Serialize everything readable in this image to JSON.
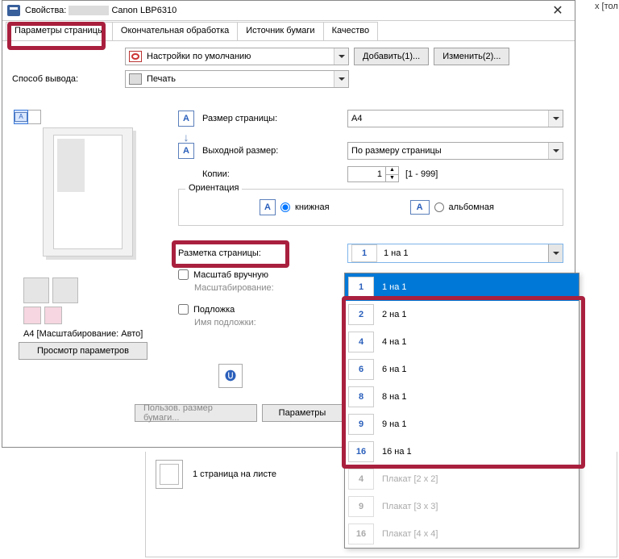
{
  "window": {
    "title_prefix": "Свойства:",
    "printer_name": "Canon LBP6310",
    "close_glyph": "✕"
  },
  "tabs": {
    "page": "Параметры страницы",
    "finish": "Окончательная обработка",
    "source": "Источник бумаги",
    "quality": "Качество"
  },
  "profile": {
    "default_settings": "Настройки по умолчанию",
    "add_btn": "Добавить(1)...",
    "edit_btn": "Изменить(2)..."
  },
  "output": {
    "label": "Способ вывода:",
    "value": "Печать"
  },
  "preview": {
    "scale_text": "A4 [Масштабирование: Авто]",
    "view_params_btn": "Просмотр параметров"
  },
  "page_size": {
    "label": "Размер страницы:",
    "value": "A4"
  },
  "out_size": {
    "label": "Выходной размер:",
    "value": "По размеру страницы"
  },
  "copies": {
    "label": "Копии:",
    "value": "1",
    "range": "[1 - 999]"
  },
  "orientation": {
    "legend": "Ориентация",
    "portrait": "книжная",
    "landscape": "альбомная"
  },
  "layout": {
    "label": "Разметка страницы:",
    "selected_num": "1",
    "selected_text": "1 на 1"
  },
  "manual_scale": {
    "label": "Масштаб вручную",
    "sub": "Масштабирование:"
  },
  "watermark": {
    "label": "Подложка",
    "sub": "Имя подложки:"
  },
  "bottom": {
    "custom_size": "Пользов. размер бумаги...",
    "params_btn": "Параметры"
  },
  "dropdown": {
    "items": [
      {
        "num": "1",
        "text": "1 на 1",
        "selected": true,
        "disabled": false
      },
      {
        "num": "2",
        "text": "2 на 1",
        "selected": false,
        "disabled": false
      },
      {
        "num": "4",
        "text": "4 на 1",
        "selected": false,
        "disabled": false
      },
      {
        "num": "6",
        "text": "6 на 1",
        "selected": false,
        "disabled": false
      },
      {
        "num": "8",
        "text": "8 на 1",
        "selected": false,
        "disabled": false
      },
      {
        "num": "9",
        "text": "9 на 1",
        "selected": false,
        "disabled": false
      },
      {
        "num": "16",
        "text": "16 на 1",
        "selected": false,
        "disabled": false
      },
      {
        "num": "4",
        "text": "Плакат [2 x 2]",
        "selected": false,
        "disabled": true
      },
      {
        "num": "9",
        "text": "Плакат [3 x 3]",
        "selected": false,
        "disabled": true
      },
      {
        "num": "16",
        "text": "Плакат [4 x 4]",
        "selected": false,
        "disabled": true
      }
    ]
  },
  "background_doc": {
    "pages_per_sheet": "1 страница на листе"
  },
  "side_text": "х [тол"
}
